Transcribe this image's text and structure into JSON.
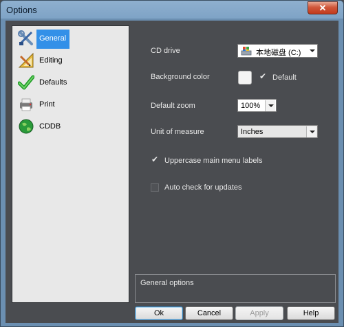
{
  "window": {
    "title": "Options",
    "close_symbol": "✕"
  },
  "sidebar": {
    "items": [
      {
        "label": "General",
        "icon": "tools-icon",
        "selected": true
      },
      {
        "label": "Editing",
        "icon": "ruler-pencil-icon"
      },
      {
        "label": "Defaults",
        "icon": "checkmark-icon"
      },
      {
        "label": "Print",
        "icon": "printer-icon"
      },
      {
        "label": "CDDB",
        "icon": "globe-icon"
      }
    ]
  },
  "settings": {
    "cd_drive": {
      "label": "CD drive",
      "value": "本地磁盘 (C:)",
      "icon": "drive-icon"
    },
    "background_color": {
      "label": "Background color",
      "default_label": "Default",
      "default_checked": true,
      "swatch_color": "#f4f4f4"
    },
    "default_zoom": {
      "label": "Default zoom",
      "value": "100%"
    },
    "unit_of_measure": {
      "label": "Unit of measure",
      "value": "Inches"
    },
    "uppercase_menu": {
      "label": "Uppercase main menu labels",
      "checked": true
    },
    "auto_check": {
      "label": "Auto check for updates",
      "checked": false
    }
  },
  "description": {
    "text": "General options"
  },
  "buttons": {
    "ok": "Ok",
    "cancel": "Cancel",
    "apply": "Apply",
    "help": "Help"
  }
}
